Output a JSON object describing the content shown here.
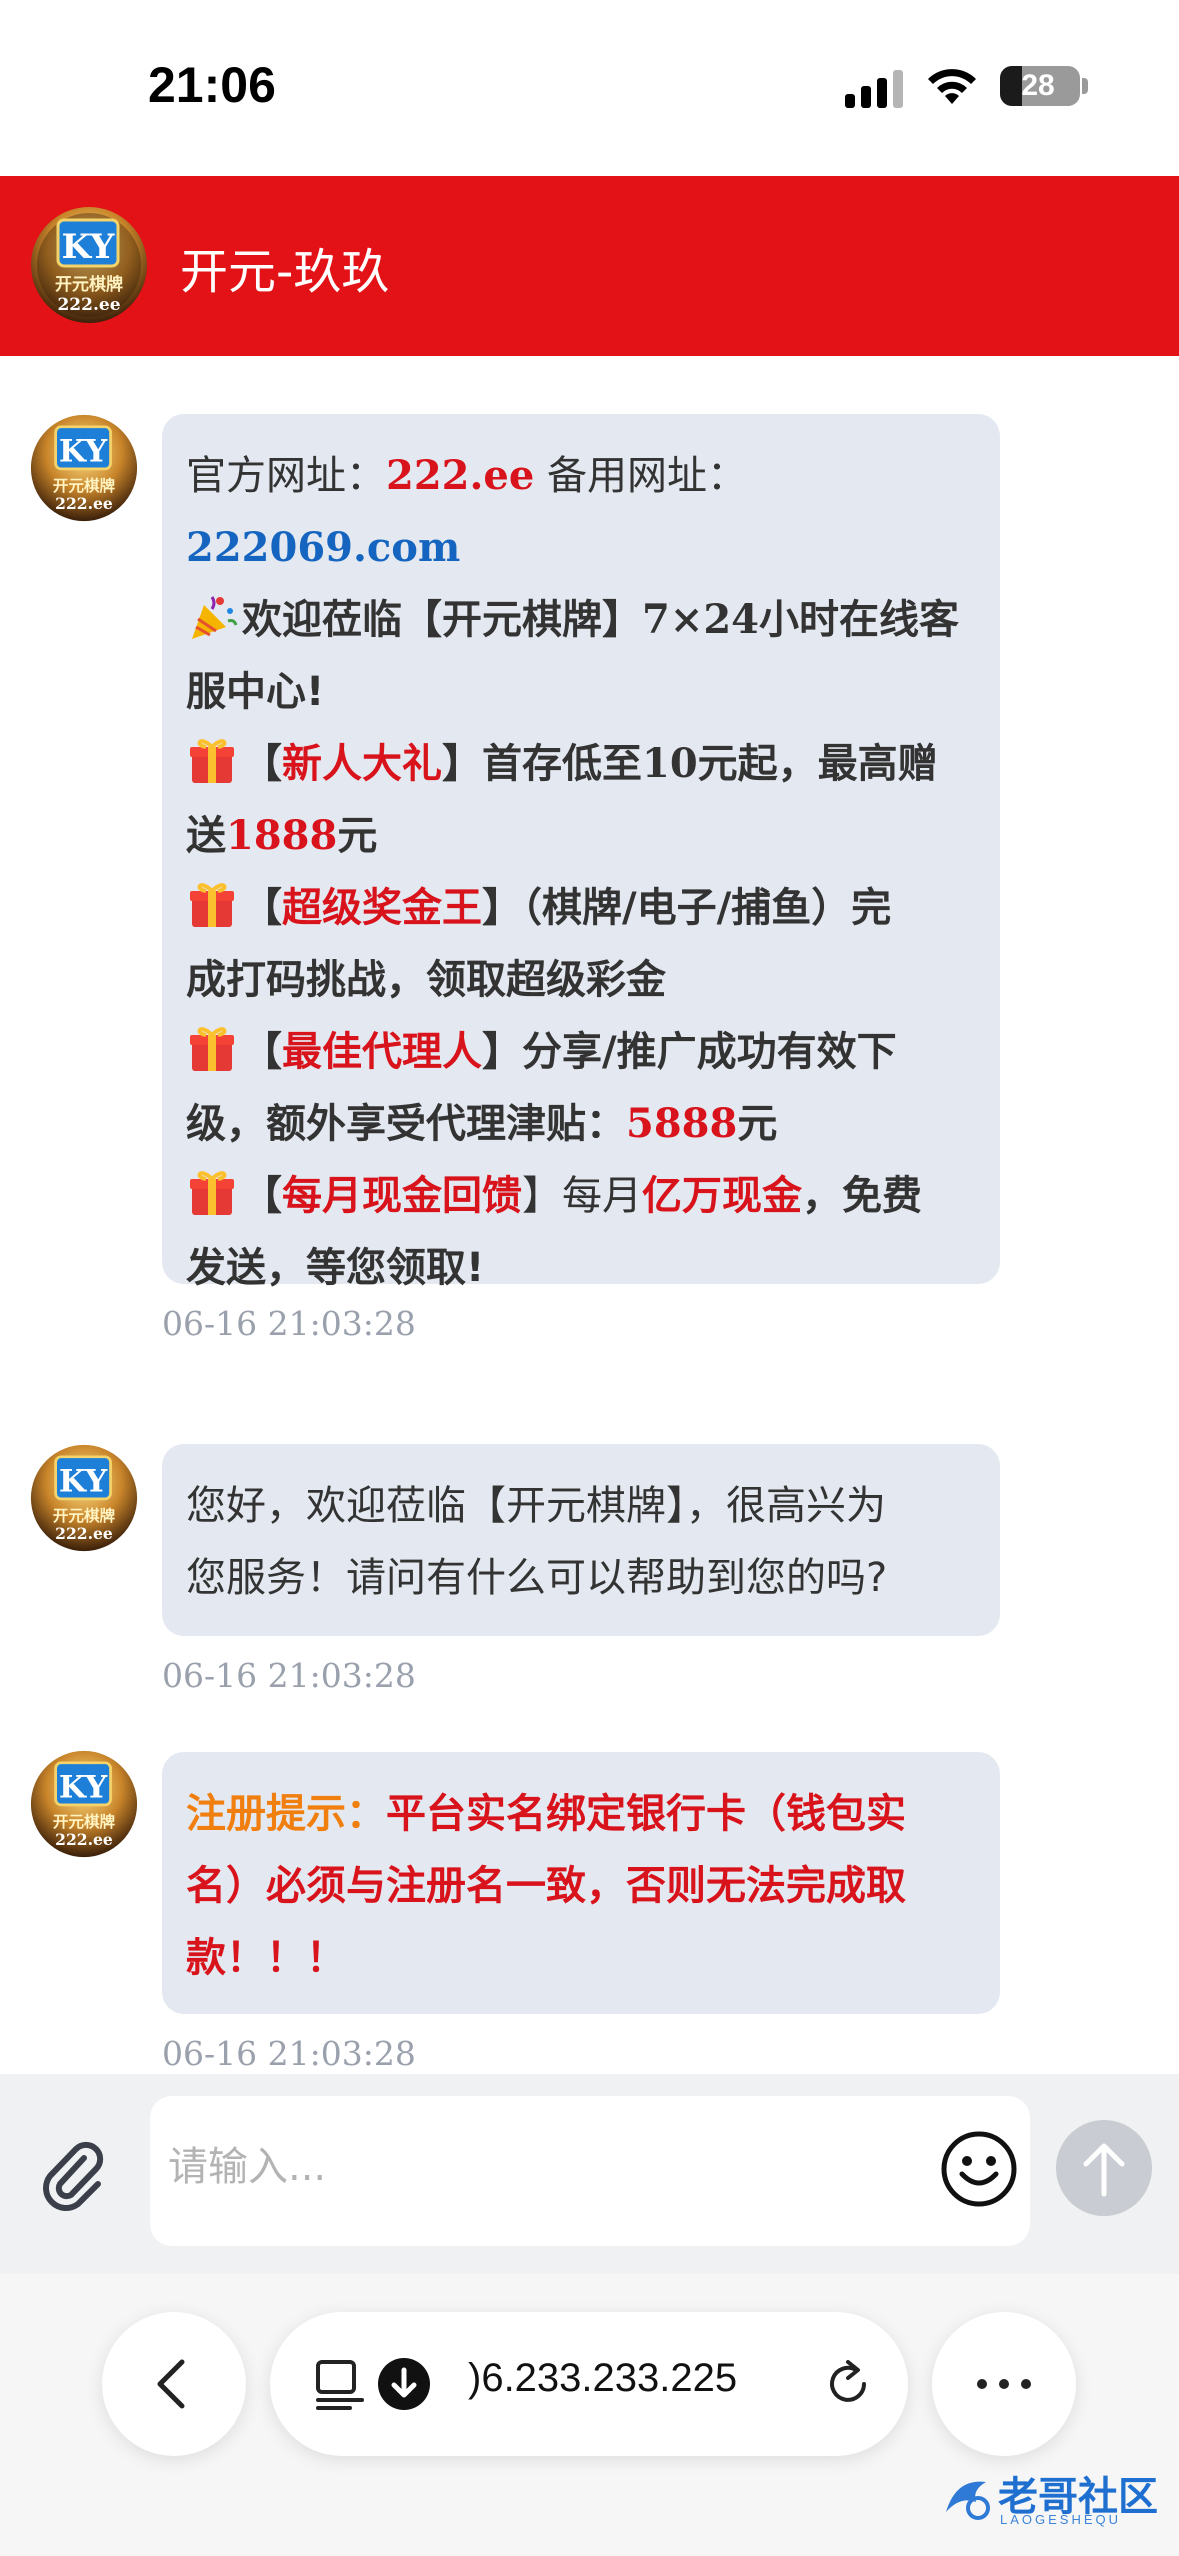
{
  "status_bar": {
    "time": "21:06",
    "battery": "28",
    "battery_fraction": 0.28
  },
  "header": {
    "title": "开元-玖玖",
    "avatar_brand": "KY",
    "avatar_text": "开元棋牌",
    "avatar_domain": "222.ee"
  },
  "messages": [
    {
      "lines": {
        "l1a": "官方网址：",
        "l1b": "222.ee",
        "l1c": " 备用网址：",
        "l2": "222069.com",
        "l3a": "欢迎莅临【开元棋牌】",
        "l3b": "7×24",
        "l3c": "小时在线客",
        "l4": "服中心!",
        "l5a": "【",
        "l5b": "新人大礼",
        "l5c": "】首存低至",
        "l5d": "10",
        "l5e": "元起，最高赠",
        "l6a": "送",
        "l6b": "1888",
        "l6c": "元",
        "l7a": "【",
        "l7b": "超级奖金王",
        "l7c": "】（棋牌/电子/捕鱼）完",
        "l8": "成打码挑战，领取超级彩金",
        "l9a": "【",
        "l9b": "最佳代理人",
        "l9c": "】分享/推广成功有效下",
        "l10a": "级，额外享受代理津贴：",
        "l10b": "5888",
        "l10c": "元",
        "l11a": "【",
        "l11b": "每月现金回馈",
        "l11c": "】每月",
        "l11d": "亿万现金",
        "l11e": "，免费",
        "l12": "发送，等您领取!"
      },
      "time": "06-16 21:03:28"
    },
    {
      "lines": {
        "l1": "您好，欢迎莅临【开元棋牌】，很高兴为",
        "l2": "您服务！请问有什么可以帮助到您的吗?"
      },
      "time": "06-16 21:03:28"
    },
    {
      "lines": {
        "l1a": "注册提示：",
        "l1b": "平台实名绑定银行卡（钱包实",
        "l2": "名）必须与注册名一致，否则无法完成取",
        "l3": "款！！！"
      },
      "time": "06-16 21:03:28"
    }
  ],
  "input": {
    "placeholder": "请输入..."
  },
  "browser": {
    "url": ")6.233.233.225"
  },
  "watermark": {
    "text": "老哥社区",
    "sub": "LAOGESHEQU"
  },
  "colors": {
    "header_red": "#e31216",
    "accent_red": "#d8131b",
    "link_blue": "#1565c0",
    "notice_orange": "#f07f10",
    "bubble_bg": "#e4e9f1"
  },
  "icons": [
    "signal-icon",
    "wifi-icon",
    "battery-icon",
    "ky-logo-avatar",
    "party-popper-icon",
    "gift-icon",
    "paperclip-icon",
    "smiley-icon",
    "send-arrow-icon",
    "chevron-left-icon",
    "reader-mode-icon",
    "download-icon",
    "reload-icon",
    "more-dots-icon"
  ]
}
